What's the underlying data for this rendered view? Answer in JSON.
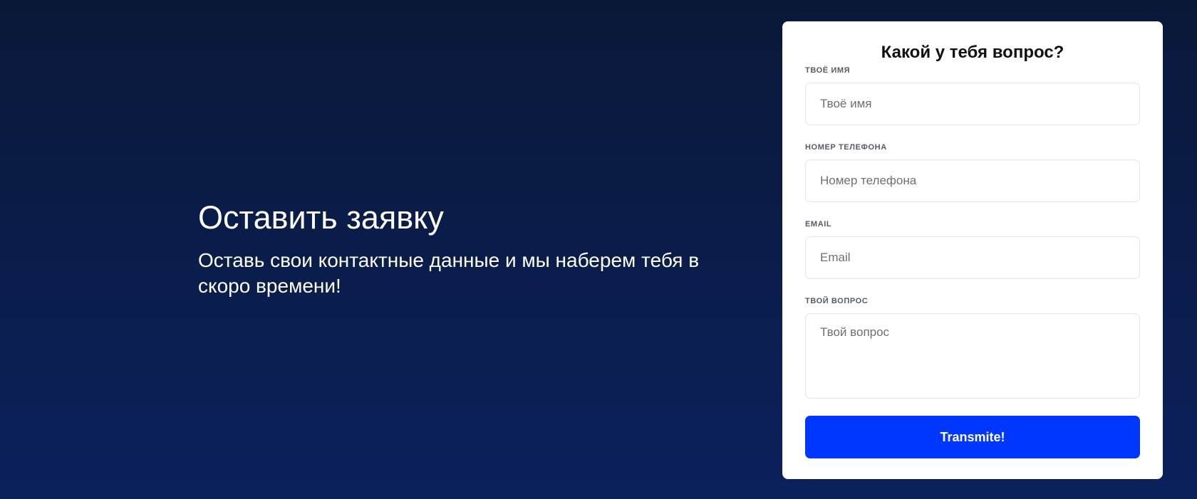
{
  "intro": {
    "title": "Оставить заявку",
    "subtitle": "Оставь свои контактные данные и мы наберем тебя в скоро времени!"
  },
  "form": {
    "title": "Какой у тебя вопрос?",
    "fields": [
      {
        "label": "Твоё имя",
        "placeholder": "Твоё имя",
        "value": ""
      },
      {
        "label": "Номер телефона",
        "placeholder": "Номер телефона",
        "value": ""
      },
      {
        "label": "Email",
        "placeholder": "Email",
        "value": ""
      },
      {
        "label": "Твой вопрос",
        "placeholder": "Твой вопрос",
        "value": ""
      }
    ],
    "submit_label": "Transmite!"
  },
  "colors": {
    "background_top": "#0a1838",
    "background_bottom": "#0b215c",
    "accent": "#0037ff",
    "card": "#ffffff"
  }
}
